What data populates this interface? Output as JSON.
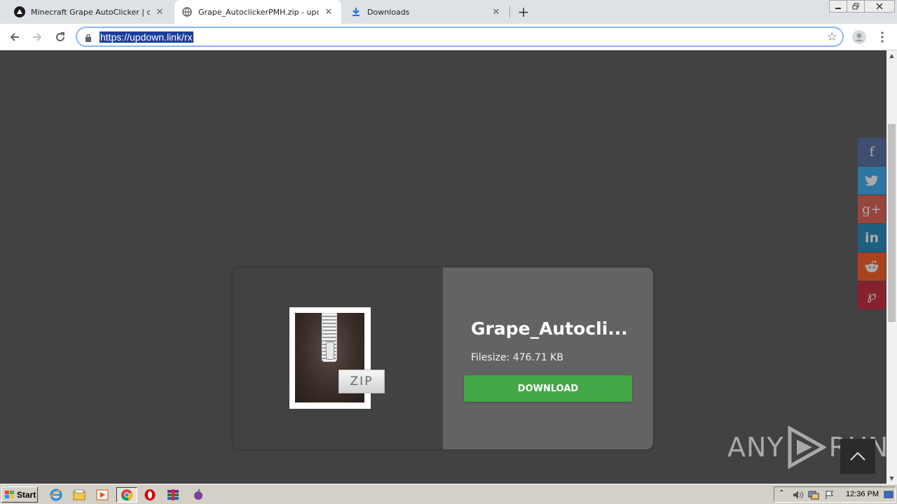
{
  "browser": {
    "tabs": [
      {
        "title": "Minecraft Grape AutoClicker | cheats",
        "icon": "minecraft-favicon-icon",
        "active": false
      },
      {
        "title": "Grape_AutoclickerPMH.zip - updown",
        "icon": "globe-icon",
        "active": true
      },
      {
        "title": "Downloads",
        "icon": "download-icon",
        "active": false
      }
    ],
    "url": "https://updown.link/rx"
  },
  "page": {
    "file_name": "Grape_Autoclicker_PMH.zip",
    "file_name_display": "Grape_Autocli...",
    "filesize": "Filesize: 476.71 KB",
    "download_label": "DOWNLOAD",
    "zip_badge": "ZIP",
    "share_buttons": [
      "facebook-icon",
      "twitter-icon",
      "google-plus-icon",
      "linkedin-icon",
      "reddit-icon",
      "pinterest-icon"
    ],
    "share_colors": [
      "#3b5998",
      "#1da1f2",
      "#dd4b39",
      "#0077b5",
      "#ff4500",
      "#bd081c"
    ],
    "watermark_left": "ANY",
    "watermark_right": "RUN"
  },
  "taskbar": {
    "start_label": "Start",
    "clock": "12:36 PM"
  }
}
